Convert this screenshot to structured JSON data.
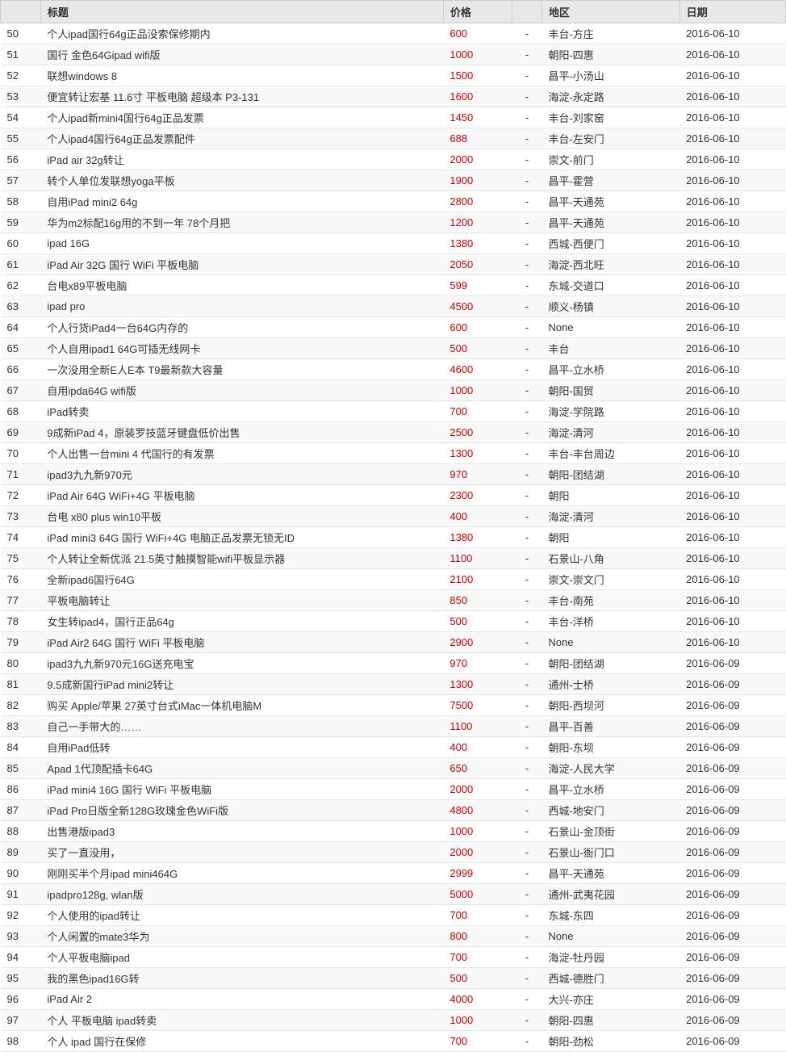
{
  "table": {
    "columns": [
      "",
      "标题",
      "价格",
      "",
      "地区",
      "日期"
    ],
    "rows": [
      {
        "num": "50",
        "title": "个人ipad国行64g正品没索保修期内",
        "price": "600",
        "sep": "-",
        "location": "丰台-方庄",
        "date": "2016-06-10"
      },
      {
        "num": "51",
        "title": "国行 金色64Gipad wifi版",
        "price": "1000",
        "sep": "-",
        "location": "朝阳-四惠",
        "date": "2016-06-10"
      },
      {
        "num": "52",
        "title": "联想windows 8",
        "price": "1500",
        "sep": "-",
        "location": "昌平-小汤山",
        "date": "2016-06-10"
      },
      {
        "num": "53",
        "title": "便宜转让宏基 11.6寸 平板电脑 超级本 P3-131",
        "price": "1600",
        "sep": "-",
        "location": "海淀-永定路",
        "date": "2016-06-10"
      },
      {
        "num": "54",
        "title": "个人ipad新mini4国行64g正品发票",
        "price": "1450",
        "sep": "-",
        "location": "丰台-刘家窑",
        "date": "2016-06-10"
      },
      {
        "num": "55",
        "title": "个人ipad4国行64g正品发票配件",
        "price": "688",
        "sep": "-",
        "location": "丰台-左安门",
        "date": "2016-06-10"
      },
      {
        "num": "56",
        "title": "iPad air 32g转让",
        "price": "2000",
        "sep": "-",
        "location": "崇文-前门",
        "date": "2016-06-10"
      },
      {
        "num": "57",
        "title": "转个人单位发联想yoga平板",
        "price": "1900",
        "sep": "-",
        "location": "昌平-霍营",
        "date": "2016-06-10"
      },
      {
        "num": "58",
        "title": "自用iPad mini2 64g",
        "price": "2800",
        "sep": "-",
        "location": "昌平-天通苑",
        "date": "2016-06-10"
      },
      {
        "num": "59",
        "title": "华为m2标配16g用的不到一年 78个月把",
        "price": "1200",
        "sep": "-",
        "location": "昌平-天通苑",
        "date": "2016-06-10"
      },
      {
        "num": "60",
        "title": "ipad 16G",
        "price": "1380",
        "sep": "-",
        "location": "西城-西便门",
        "date": "2016-06-10"
      },
      {
        "num": "61",
        "title": "iPad Air 32G 国行 WiFi 平板电脑",
        "price": "2050",
        "sep": "-",
        "location": "海淀-西北旺",
        "date": "2016-06-10"
      },
      {
        "num": "62",
        "title": "台电x89平板电脑",
        "price": "599",
        "sep": "-",
        "location": "东城-交道口",
        "date": "2016-06-10"
      },
      {
        "num": "63",
        "title": "ipad pro",
        "price": "4500",
        "sep": "-",
        "location": "顺义-杨镇",
        "date": "2016-06-10"
      },
      {
        "num": "64",
        "title": "个人行货iPad4一台64G内存的",
        "price": "600",
        "sep": "-",
        "location": "None",
        "date": "2016-06-10"
      },
      {
        "num": "65",
        "title": "个人自用ipad1 64G可插无线网卡",
        "price": "500",
        "sep": "-",
        "location": "丰台",
        "date": "2016-06-10"
      },
      {
        "num": "66",
        "title": "一次没用全新E人E本 T9最新款大容量",
        "price": "4600",
        "sep": "-",
        "location": "昌平-立水桥",
        "date": "2016-06-10"
      },
      {
        "num": "67",
        "title": "自用ipda64G wifi版",
        "price": "1000",
        "sep": "-",
        "location": "朝阳-国贸",
        "date": "2016-06-10"
      },
      {
        "num": "68",
        "title": "iPad转卖",
        "price": "700",
        "sep": "-",
        "location": "海淀-学院路",
        "date": "2016-06-10"
      },
      {
        "num": "69",
        "title": "9成新iPad 4，原装罗技蓝牙键盘低价出售",
        "price": "2500",
        "sep": "-",
        "location": "海淀-清河",
        "date": "2016-06-10"
      },
      {
        "num": "70",
        "title": "个人出售一台mini 4 代国行的有发票",
        "price": "1300",
        "sep": "-",
        "location": "丰台-丰台周边",
        "date": "2016-06-10"
      },
      {
        "num": "71",
        "title": "ipad3九九新970元",
        "price": "970",
        "sep": "-",
        "location": "朝阳-团结湖",
        "date": "2016-06-10"
      },
      {
        "num": "72",
        "title": "iPad Air 64G WiFi+4G 平板电脑",
        "price": "2300",
        "sep": "-",
        "location": "朝阳",
        "date": "2016-06-10"
      },
      {
        "num": "73",
        "title": "台电 x80 plus win10平板",
        "price": "400",
        "sep": "-",
        "location": "海淀-清河",
        "date": "2016-06-10"
      },
      {
        "num": "74",
        "title": "iPad mini3 64G 国行 WiFi+4G 电脑正品发票无锁无ID",
        "price": "1380",
        "sep": "-",
        "location": "朝阳",
        "date": "2016-06-10"
      },
      {
        "num": "75",
        "title": "个人转让全新优派 21.5英寸触摸智能wifi平板显示器",
        "price": "1100",
        "sep": "-",
        "location": "石景山-八角",
        "date": "2016-06-10"
      },
      {
        "num": "76",
        "title": "全新ipad6国行64G",
        "price": "2100",
        "sep": "-",
        "location": "崇文-崇文门",
        "date": "2016-06-10"
      },
      {
        "num": "77",
        "title": "平板电脑转让",
        "price": "850",
        "sep": "-",
        "location": "丰台-南苑",
        "date": "2016-06-10"
      },
      {
        "num": "78",
        "title": "女生转ipad4，国行正品64g",
        "price": "500",
        "sep": "-",
        "location": "丰台-洋桥",
        "date": "2016-06-10"
      },
      {
        "num": "79",
        "title": "iPad Air2 64G 国行 WiFi 平板电脑",
        "price": "2900",
        "sep": "-",
        "location": "None",
        "date": "2016-06-10"
      },
      {
        "num": "80",
        "title": "ipad3九九新970元16G送充电宝",
        "price": "970",
        "sep": "-",
        "location": "朝阳-团结湖",
        "date": "2016-06-09"
      },
      {
        "num": "81",
        "title": "9.5成新国行iPad mini2转让",
        "price": "1300",
        "sep": "-",
        "location": "通州-士桥",
        "date": "2016-06-09"
      },
      {
        "num": "82",
        "title": "购买 Apple/苹果 27英寸台式iMac一体机电脑M",
        "price": "7500",
        "sep": "-",
        "location": "朝阳-西坝河",
        "date": "2016-06-09"
      },
      {
        "num": "83",
        "title": "自己一手带大的……",
        "price": "1100",
        "sep": "-",
        "location": "昌平-百善",
        "date": "2016-06-09"
      },
      {
        "num": "84",
        "title": "自用iPad低转",
        "price": "400",
        "sep": "-",
        "location": "朝阳-东坝",
        "date": "2016-06-09"
      },
      {
        "num": "85",
        "title": "Apad 1代顶配插卡64G",
        "price": "650",
        "sep": "-",
        "location": "海淀-人民大学",
        "date": "2016-06-09"
      },
      {
        "num": "86",
        "title": "iPad mini4 16G 国行 WiFi 平板电脑",
        "price": "2000",
        "sep": "-",
        "location": "昌平-立水桥",
        "date": "2016-06-09"
      },
      {
        "num": "87",
        "title": "iPad Pro日版全新128G玫瑰金色WiFi版",
        "price": "4800",
        "sep": "-",
        "location": "西城-地安门",
        "date": "2016-06-09"
      },
      {
        "num": "88",
        "title": "出售港版ipad3",
        "price": "1000",
        "sep": "-",
        "location": "石景山-金顶街",
        "date": "2016-06-09"
      },
      {
        "num": "89",
        "title": "买了一直没用，",
        "price": "2000",
        "sep": "-",
        "location": "石景山-衙门口",
        "date": "2016-06-09"
      },
      {
        "num": "90",
        "title": "刚刚买半个月ipad mini464G",
        "price": "2999",
        "sep": "-",
        "location": "昌平-天通苑",
        "date": "2016-06-09"
      },
      {
        "num": "91",
        "title": "ipadpro128g, wlan版",
        "price": "5000",
        "sep": "-",
        "location": "通州-武夷花园",
        "date": "2016-06-09"
      },
      {
        "num": "92",
        "title": "个人使用的ipad转让",
        "price": "700",
        "sep": "-",
        "location": "东城-东四",
        "date": "2016-06-09"
      },
      {
        "num": "93",
        "title": "个人闲置的mate3华为",
        "price": "800",
        "sep": "-",
        "location": "None",
        "date": "2016-06-09"
      },
      {
        "num": "94",
        "title": "个人平板电脑ipad",
        "price": "700",
        "sep": "-",
        "location": "海淀-牡丹园",
        "date": "2016-06-09"
      },
      {
        "num": "95",
        "title": "我的黑色ipad16G转",
        "price": "500",
        "sep": "-",
        "location": "西城-德胜门",
        "date": "2016-06-09"
      },
      {
        "num": "96",
        "title": "iPad Air 2",
        "price": "4000",
        "sep": "-",
        "location": "大兴-亦庄",
        "date": "2016-06-09"
      },
      {
        "num": "97",
        "title": "个人 平板电脑 ipad转卖",
        "price": "1000",
        "sep": "-",
        "location": "朝阳-四惠",
        "date": "2016-06-09"
      },
      {
        "num": "98",
        "title": "个人 ipad 国行在保修",
        "price": "700",
        "sep": "-",
        "location": "朝阳-劲松",
        "date": "2016-06-09"
      }
    ]
  }
}
